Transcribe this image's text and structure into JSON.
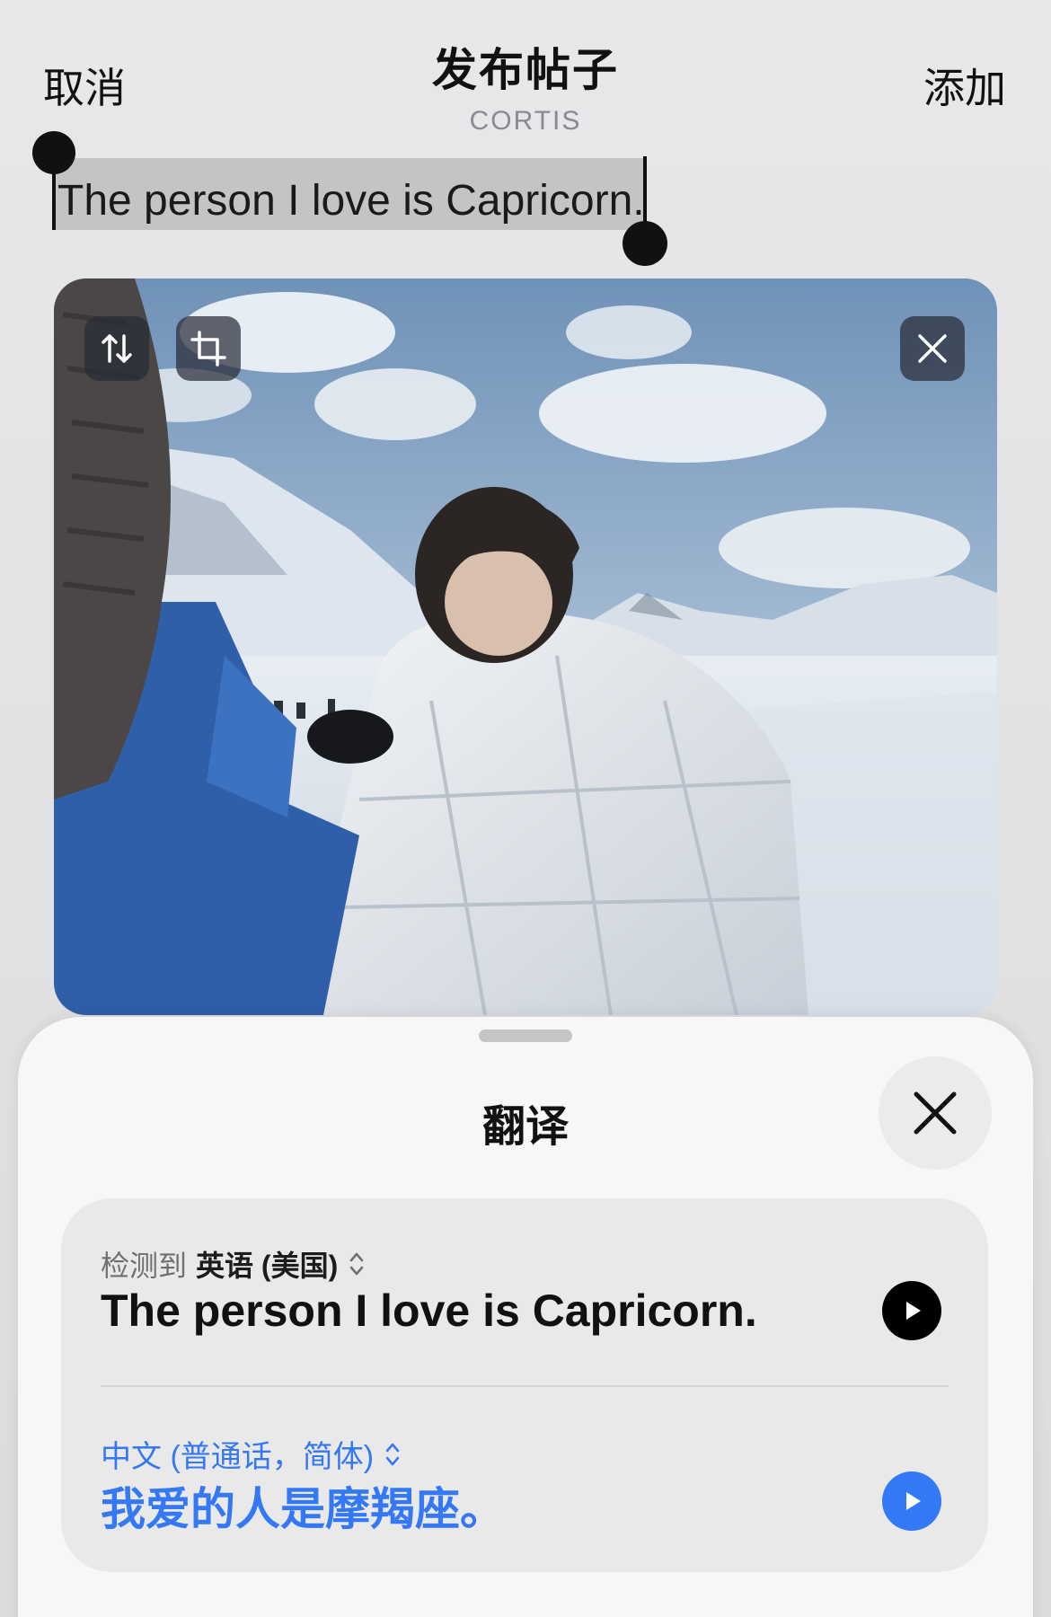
{
  "header": {
    "cancel_label": "取消",
    "title": "发布帖子",
    "subtitle": "CORTIS",
    "add_label": "添加"
  },
  "post": {
    "text": "The person I love is Capricorn."
  },
  "photo": {
    "buttons": [
      "swap-order-icon",
      "crop-icon",
      "close-icon"
    ]
  },
  "translate": {
    "title": "翻译",
    "source": {
      "detected_label": "检测到",
      "language": "英语 (美国)",
      "text": "The person I love is Capricorn."
    },
    "target": {
      "language": "中文 (普通话，简体)",
      "text": "我爱的人是摩羯座。"
    }
  },
  "colors": {
    "accent": "#3478f6",
    "background": "#e6e6e8",
    "sheet": "#f7f7f8"
  }
}
